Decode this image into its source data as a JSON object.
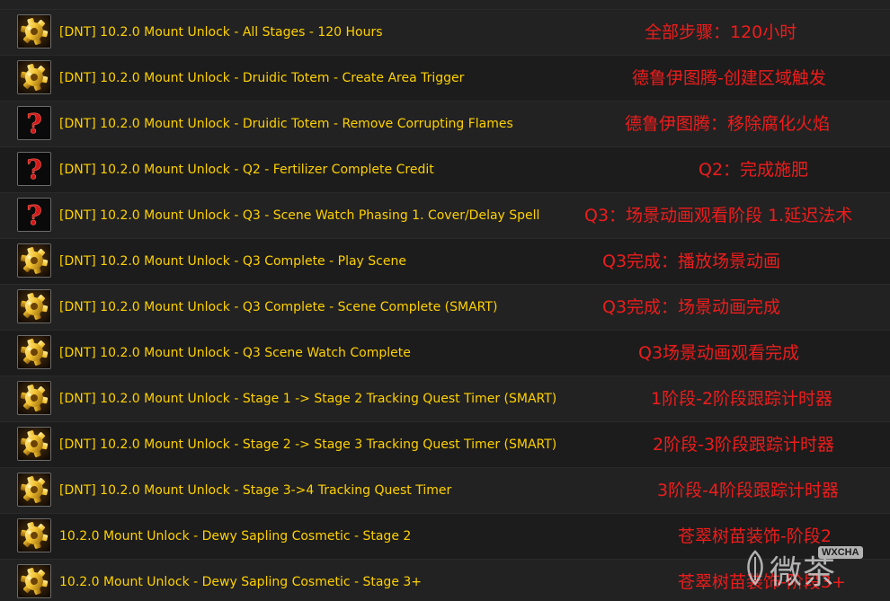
{
  "rows": [
    {
      "icon": "gear",
      "title": "[DNT] 10.2.0 Mount Unlock - All Stages - 120 Hours",
      "note": "全部步骤：120小时"
    },
    {
      "icon": "gear",
      "title": "[DNT] 10.2.0 Mount Unlock - Druidic Totem - Create Area Trigger",
      "note": "德鲁伊图腾-创建区域触发"
    },
    {
      "icon": "question",
      "title": "[DNT] 10.2.0 Mount Unlock - Druidic Totem - Remove Corrupting Flames",
      "note": "德鲁伊图腾：移除腐化火焰"
    },
    {
      "icon": "question",
      "title": "[DNT] 10.2.0 Mount Unlock - Q2 - Fertilizer Complete Credit",
      "note": "Q2：完成施肥"
    },
    {
      "icon": "question",
      "title": "[DNT] 10.2.0 Mount Unlock - Q3 - Scene Watch Phasing 1. Cover/Delay Spell",
      "note": "Q3：场景动画观看阶段 1.延迟法术"
    },
    {
      "icon": "gear",
      "title": "[DNT] 10.2.0 Mount Unlock - Q3 Complete - Play Scene",
      "note": "Q3完成：播放场景动画"
    },
    {
      "icon": "gear",
      "title": "[DNT] 10.2.0 Mount Unlock - Q3 Complete - Scene Complete (SMART)",
      "note": "Q3完成：场景动画完成"
    },
    {
      "icon": "gear",
      "title": "[DNT] 10.2.0 Mount Unlock - Q3 Scene Watch Complete",
      "note": "Q3场景动画观看完成"
    },
    {
      "icon": "gear",
      "title": "[DNT] 10.2.0 Mount Unlock - Stage 1 -> Stage 2 Tracking Quest Timer (SMART)",
      "note": "1阶段-2阶段跟踪计时器"
    },
    {
      "icon": "gear",
      "title": "[DNT] 10.2.0 Mount Unlock - Stage 2 -> Stage 3 Tracking Quest Timer (SMART)",
      "note": "2阶段-3阶段跟踪计时器"
    },
    {
      "icon": "gear",
      "title": "[DNT] 10.2.0 Mount Unlock - Stage 3->4 Tracking Quest Timer",
      "note": "3阶段-4阶段跟踪计时器"
    },
    {
      "icon": "gear",
      "title": "10.2.0 Mount Unlock - Dewy Sapling Cosmetic - Stage 2",
      "note": "苍翠树苗装饰-阶段2"
    },
    {
      "icon": "gear",
      "title": "10.2.0 Mount Unlock - Dewy Sapling Cosmetic - Stage 3+",
      "note": "苍翠树苗装饰-阶段3+"
    }
  ],
  "watermark": {
    "text": "微茶",
    "badge": "WXCHA"
  },
  "colors": {
    "title": "#ffd100",
    "note": "#ee1c1c",
    "row_odd": "#222222",
    "row_even": "#1c1c1c"
  }
}
